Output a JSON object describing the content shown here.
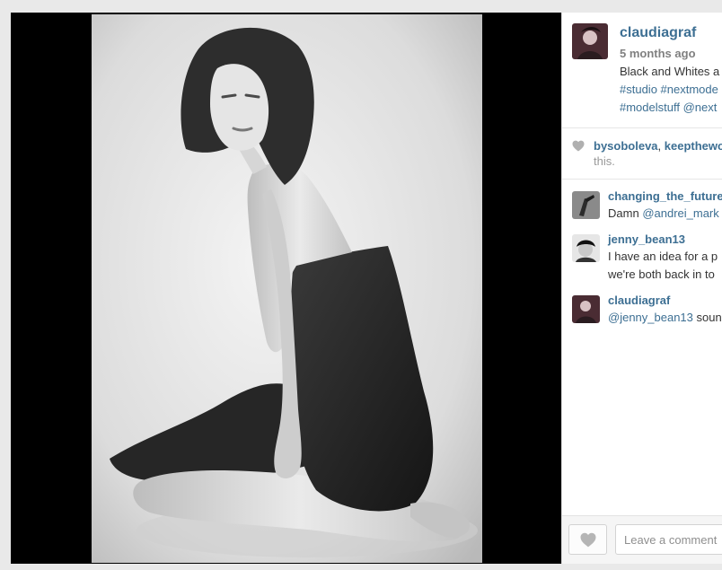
{
  "post": {
    "username": "claudiagraf",
    "time_ago": "5 months ago",
    "caption_line1": "Black and Whites a",
    "caption_tags_line2_a": "#studio",
    "caption_tags_line2_b": "#nextmode",
    "caption_tags_line3_a": "#modelstuff",
    "caption_tags_line3_b": "@next"
  },
  "likes": {
    "user1": "bysoboleva",
    "separator": ",",
    "user2": "keepthewo",
    "suffix": "this."
  },
  "comments": [
    {
      "username": "changing_the_future",
      "text_prefix": "Damn",
      "mention": "@andrei_mark",
      "text_line2": ""
    },
    {
      "username": "jenny_bean13",
      "text_line1": "I have an idea for a p",
      "text_line2": "we're both back in to"
    },
    {
      "username": "claudiagraf",
      "mention": "@jenny_bean13",
      "text_suffix": "soun"
    }
  ],
  "footer": {
    "comment_placeholder": "Leave a comment"
  },
  "colors": {
    "link": "#3d6f93",
    "text": "#333333"
  },
  "icons": {
    "likes": "heart-icon",
    "like_button": "heart-icon"
  }
}
